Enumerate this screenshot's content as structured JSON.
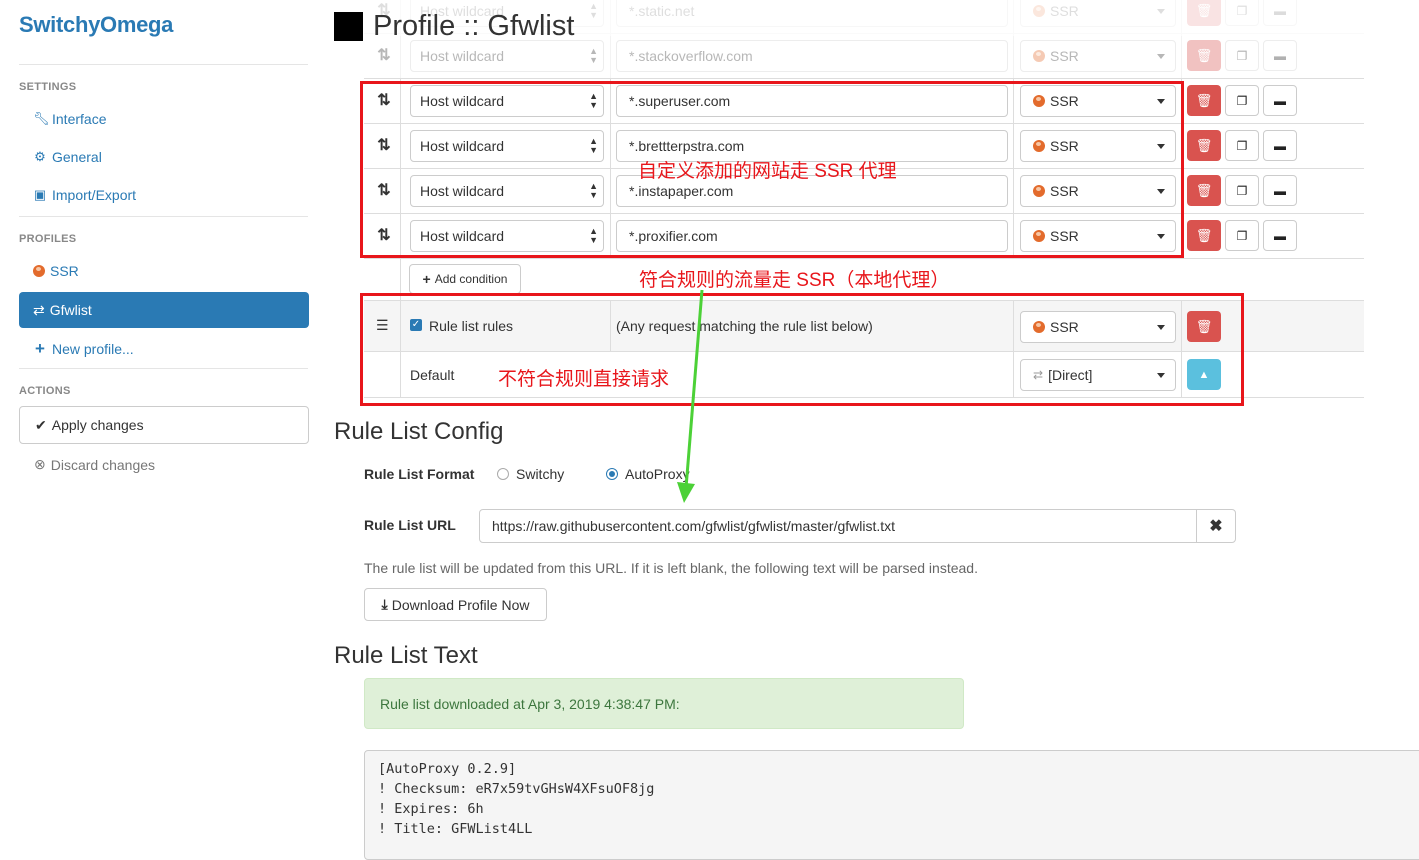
{
  "app": {
    "brand": "SwitchyOmega"
  },
  "sidebar": {
    "settings_header": "SETTINGS",
    "interface": "Interface",
    "general": "General",
    "import_export": "Import/Export",
    "profiles_header": "PROFILES",
    "profile_ssr": "SSR",
    "profile_gfwlist": "Gfwlist",
    "new_profile": "New profile...",
    "actions_header": "ACTIONS",
    "apply": "Apply changes",
    "discard": "Discard changes"
  },
  "page": {
    "title": "Profile :: Gfwlist"
  },
  "rules": [
    {
      "type": "Host wildcard",
      "pattern": "*.static.net",
      "profile": "SSR"
    },
    {
      "type": "Host wildcard",
      "pattern": "*.stackoverflow.com",
      "profile": "SSR"
    },
    {
      "type": "Host wildcard",
      "pattern": "*.superuser.com",
      "profile": "SSR"
    },
    {
      "type": "Host wildcard",
      "pattern": "*.brettterpstra.com",
      "profile": "SSR"
    },
    {
      "type": "Host wildcard",
      "pattern": "*.instapaper.com",
      "profile": "SSR"
    },
    {
      "type": "Host wildcard",
      "pattern": "*.proxifier.com",
      "profile": "SSR"
    }
  ],
  "add_condition": "Add condition",
  "rule_list_row": {
    "label": "Rule list rules",
    "desc": "(Any request matching the rule list below)",
    "profile": "SSR"
  },
  "default_row": {
    "label": "Default",
    "profile": "[Direct]"
  },
  "config": {
    "title": "Rule List Config",
    "format_label": "Rule List Format",
    "format_switchy": "Switchy",
    "format_autoproxy": "AutoProxy",
    "url_label": "Rule List URL",
    "url_value": "https://raw.githubusercontent.com/gfwlist/gfwlist/master/gfwlist.txt",
    "help": "The rule list will be updated from this URL. If it is left blank, the following text will be parsed instead.",
    "download_btn": "Download Profile Now"
  },
  "rule_text": {
    "title": "Rule List Text",
    "alert": "Rule list downloaded at Apr 3, 2019 4:38:47 PM:",
    "lines": [
      "[AutoProxy 0.2.9]",
      "! Checksum: eR7x59tvGHsW4XFsuOF8jg",
      "! Expires: 6h",
      "! Title: GFWList4LL"
    ]
  },
  "annotations": {
    "custom": "自定义添加的网站走 SSR 代理",
    "match": "符合规则的流量走 SSR（本地代理）",
    "nomatch": "不符合规则直接请求"
  },
  "colors": {
    "accent": "#2a7ab4",
    "danger": "#d9534f",
    "annotation": "#e8161b",
    "arrow": "#4cd137"
  }
}
